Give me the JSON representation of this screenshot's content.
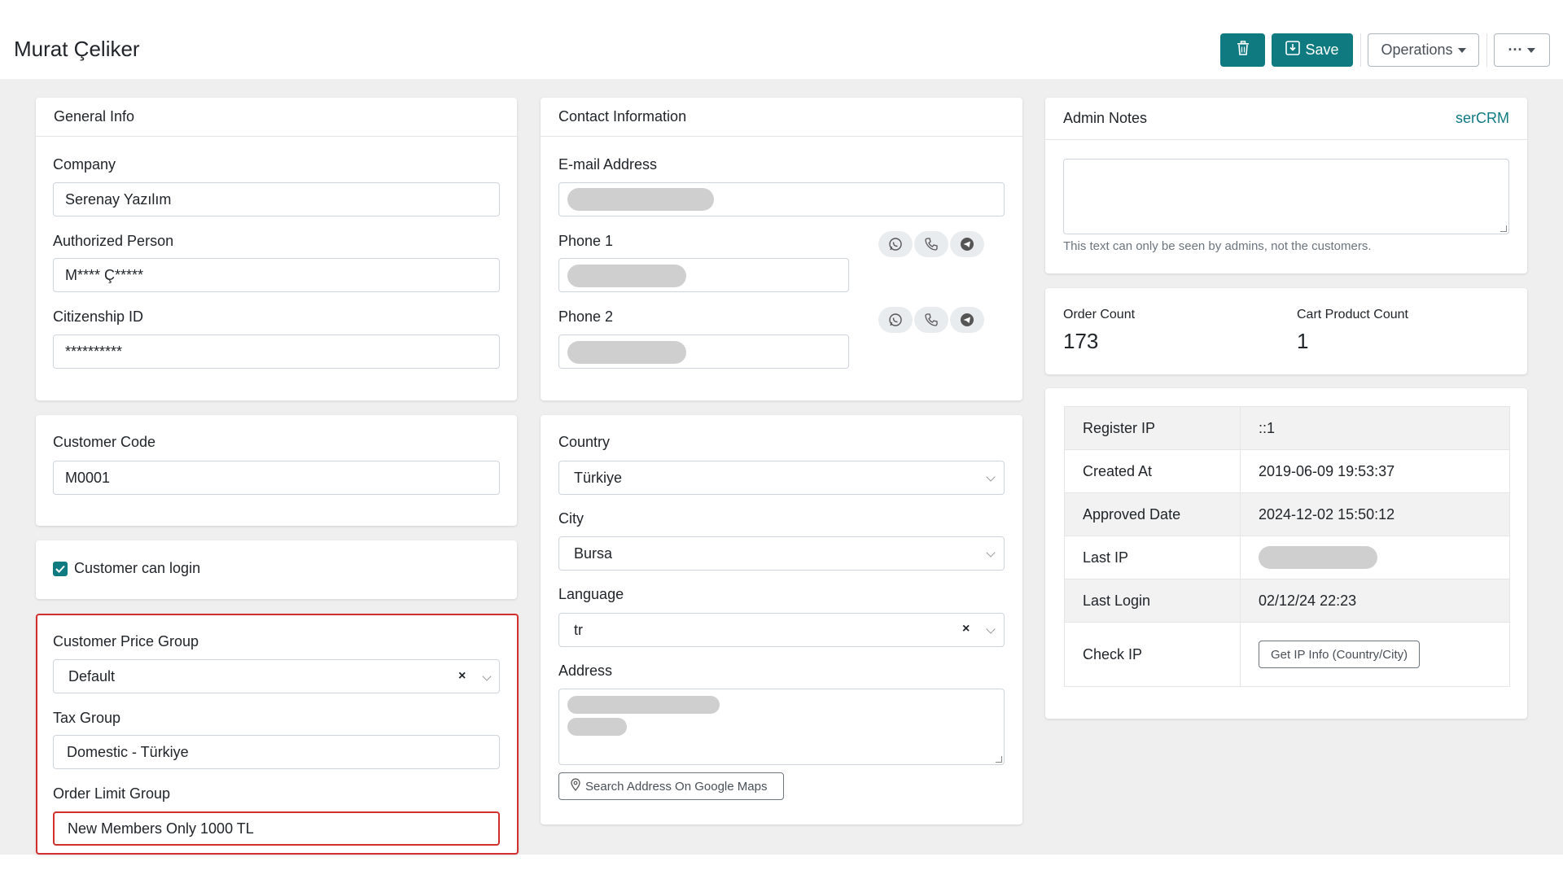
{
  "header": {
    "title": "Murat Çeliker",
    "save_label": "Save",
    "operations_label": "Operations",
    "more_label": "···",
    "accent_color": "#0f7a80"
  },
  "general_info": {
    "title": "General Info",
    "company_label": "Company",
    "company_value": "Serenay Yazılım",
    "authorized_person_label": "Authorized Person",
    "authorized_person_value": "M**** Ç*****",
    "citizenship_id_label": "Citizenship ID",
    "citizenship_id_value": "**********"
  },
  "customer_code": {
    "label": "Customer Code",
    "value": "M0001"
  },
  "login": {
    "label": "Customer can login",
    "checked": true
  },
  "groups": {
    "price_group_label": "Customer Price Group",
    "price_group_value": "Default",
    "tax_group_label": "Tax Group",
    "tax_group_value": "Domestic - Türkiye",
    "order_limit_label": "Order Limit Group",
    "order_limit_value": "New Members Only 1000 TL"
  },
  "contact": {
    "title": "Contact Information",
    "email_label": "E-mail Address",
    "phone1_label": "Phone 1",
    "phone2_label": "Phone 2",
    "icons": [
      "whatsapp-icon",
      "phone-icon",
      "telegram-icon"
    ]
  },
  "location": {
    "country_label": "Country",
    "country_value": "Türkiye",
    "city_label": "City",
    "city_value": "Bursa",
    "language_label": "Language",
    "language_value": "tr",
    "address_label": "Address",
    "maps_button_label": "Search Address On Google Maps"
  },
  "admin_notes": {
    "title": "Admin Notes",
    "brand_link": "serCRM",
    "note_value": "",
    "help_text": "This text can only be seen by admins, not the customers."
  },
  "stats": {
    "order_count_label": "Order Count",
    "order_count_value": "173",
    "cart_count_label": "Cart Product Count",
    "cart_count_value": "1"
  },
  "info": {
    "rows": [
      {
        "key": "Register IP",
        "value": "::1"
      },
      {
        "key": "Created At",
        "value": "2019-06-09 19:53:37"
      },
      {
        "key": "Approved Date",
        "value": "2024-12-02 15:50:12"
      },
      {
        "key": "Last IP",
        "value": ""
      },
      {
        "key": "Last Login",
        "value": "02/12/24 22:23"
      },
      {
        "key": "Check IP",
        "value": ""
      }
    ],
    "check_ip_button": "Get IP Info (Country/City)"
  }
}
